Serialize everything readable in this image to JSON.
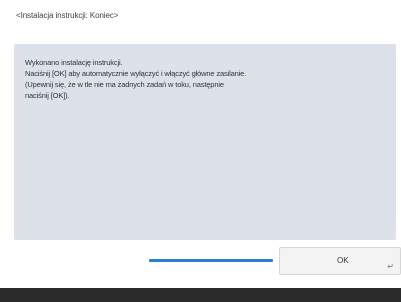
{
  "screen": {
    "title": "<Instalacja instrukcji: Koniec>"
  },
  "message": {
    "lines": [
      "Wykonano instalację instrukcji.",
      "Naciśnij [OK] aby automatycznie wyłączyć i włączyć główne zasilanie.",
      "(Upewnij się, że w tle nie ma żadnych zadań w toku, następnie",
      "naciśnij [OK])."
    ]
  },
  "buttons": {
    "ok_label": "OK",
    "ok_icon": "return-arrow-icon"
  },
  "colors": {
    "panel": "#dde2ea",
    "accent": "#2c7fd6",
    "bottom_bar": "#2b2b2b"
  }
}
